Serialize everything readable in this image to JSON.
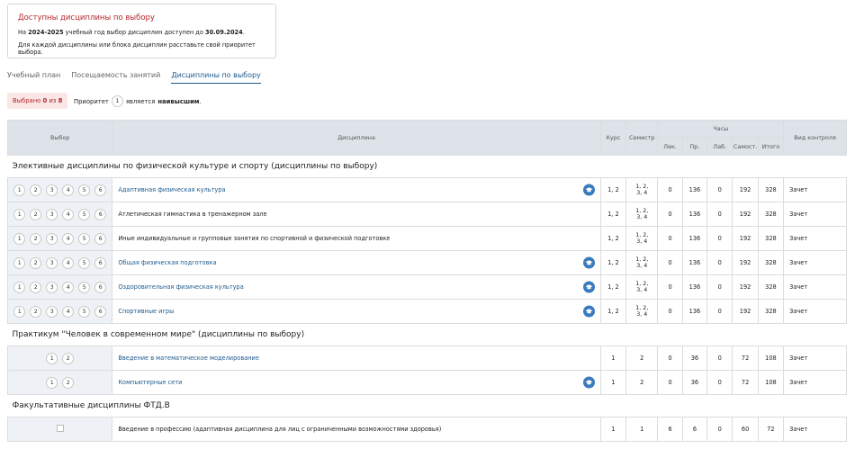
{
  "notice": {
    "title": "Доступны дисциплины по выбору",
    "line1_pre": "На ",
    "line1_year": "2024-2025",
    "line1_mid": " учебный год выбор дисциплин доступен до ",
    "line1_date": "30.09.2024",
    "line1_end": ".",
    "line2": "Для каждой дисциплины или блока дисциплин расставьте свой приоритет выбора."
  },
  "tabs": [
    {
      "label": "Учебный план",
      "active": false
    },
    {
      "label": "Посещаемость занятий",
      "active": false
    },
    {
      "label": "Дисциплины по выбору",
      "active": true
    }
  ],
  "chosen": {
    "pre": "Выбрано ",
    "count": "0",
    "mid": " из ",
    "total": "8"
  },
  "priority": {
    "pre": "Приоритет",
    "value": "1",
    "mid": "является",
    "bold": "наивысшим",
    "end": "."
  },
  "headers": {
    "choice": "Выбор",
    "discipline": "Дисциплина",
    "course": "Курс",
    "semester": "Семестр",
    "hours": "Часы",
    "lec": "Лек.",
    "pr": "Пр.",
    "lab": "Лаб.",
    "self": "Самост.",
    "total": "Итого",
    "control": "Вид контроля"
  },
  "groups": [
    {
      "title": "Элективные дисциплины по физической культуре и спорту (дисциплины по выбору)",
      "options": [
        "1",
        "2",
        "3",
        "4",
        "5",
        "6"
      ],
      "rows": [
        {
          "name": "Адаптивная физическая культура",
          "link": true,
          "icon": true,
          "course": "1, 2",
          "sem1": "1, 2,",
          "sem2": "3, 4",
          "lec": "0",
          "pr": "136",
          "lab": "0",
          "self": "192",
          "total": "328",
          "control": "Зачет"
        },
        {
          "name": "Атлетическая гимнастика в тренажерном зале",
          "link": false,
          "icon": false,
          "course": "1, 2",
          "sem1": "1, 2,",
          "sem2": "3, 4",
          "lec": "0",
          "pr": "136",
          "lab": "0",
          "self": "192",
          "total": "328",
          "control": "Зачет"
        },
        {
          "name": "Иные индивидуальные и групповые занятия по спортивной и физической подготовке",
          "link": false,
          "icon": false,
          "course": "1, 2",
          "sem1": "1, 2,",
          "sem2": "3, 4",
          "lec": "0",
          "pr": "136",
          "lab": "0",
          "self": "192",
          "total": "328",
          "control": "Зачет"
        },
        {
          "name": "Общая физическая подготовка",
          "link": true,
          "icon": true,
          "course": "1, 2",
          "sem1": "1, 2,",
          "sem2": "3, 4",
          "lec": "0",
          "pr": "136",
          "lab": "0",
          "self": "192",
          "total": "328",
          "control": "Зачет"
        },
        {
          "name": "Оздоровительная физическая культура",
          "link": true,
          "icon": true,
          "course": "1, 2",
          "sem1": "1, 2,",
          "sem2": "3, 4",
          "lec": "0",
          "pr": "136",
          "lab": "0",
          "self": "192",
          "total": "328",
          "control": "Зачет"
        },
        {
          "name": "Спортивные игры",
          "link": true,
          "icon": true,
          "course": "1, 2",
          "sem1": "1, 2,",
          "sem2": "3, 4",
          "lec": "0",
          "pr": "136",
          "lab": "0",
          "self": "192",
          "total": "328",
          "control": "Зачет"
        }
      ]
    },
    {
      "title": "Практикум \"Человек в современном мире\" (дисциплины по выбору)",
      "options": [
        "1",
        "2"
      ],
      "rows": [
        {
          "name": "Введение в математическое моделирование",
          "link": true,
          "icon": false,
          "course": "1",
          "sem1": "2",
          "sem2": "",
          "lec": "0",
          "pr": "36",
          "lab": "0",
          "self": "72",
          "total": "108",
          "control": "Зачет"
        },
        {
          "name": "Компьютерные сети",
          "link": true,
          "icon": true,
          "course": "1",
          "sem1": "2",
          "sem2": "",
          "lec": "0",
          "pr": "36",
          "lab": "0",
          "self": "72",
          "total": "108",
          "control": "Зачет"
        }
      ]
    },
    {
      "title": "Факультативные дисциплины ФТД.В",
      "options": [],
      "rows": [
        {
          "name": "Введение в профессию (адаптивная дисциплина для лиц с ограниченными возможностями здоровья)",
          "link": false,
          "icon": false,
          "course": "1",
          "sem1": "1",
          "sem2": "",
          "lec": "6",
          "pr": "6",
          "lab": "0",
          "self": "60",
          "total": "72",
          "control": "Зачет"
        }
      ]
    }
  ]
}
